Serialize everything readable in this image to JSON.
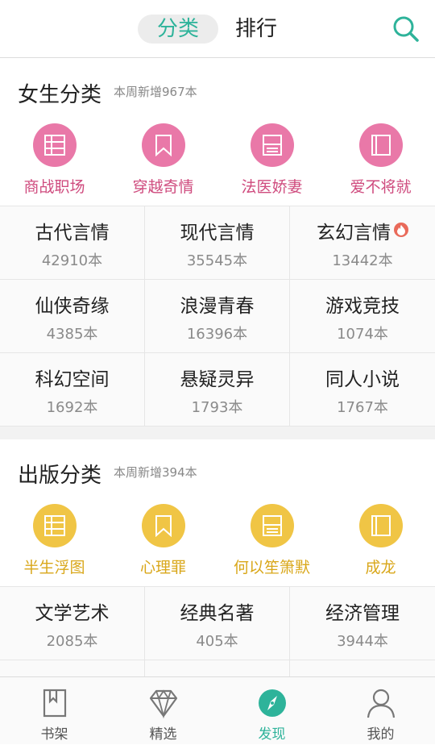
{
  "header": {
    "tabs": [
      {
        "label": "分类",
        "active": true
      },
      {
        "label": "排行",
        "active": false
      }
    ],
    "search_icon": "search-icon",
    "accent_color": "#2eb39a"
  },
  "female": {
    "title": "女生分类",
    "subtitle": "本周新增967本",
    "icon_color": "#e978a8",
    "icons": [
      {
        "label": "商战职场",
        "icon": "list-icon"
      },
      {
        "label": "穿越奇情",
        "icon": "bookmark-icon"
      },
      {
        "label": "法医娇妻",
        "icon": "document-icon"
      },
      {
        "label": "爱不将就",
        "icon": "book-icon"
      }
    ],
    "categories": [
      {
        "name": "古代言情",
        "count": "42910本"
      },
      {
        "name": "现代言情",
        "count": "35545本"
      },
      {
        "name": "玄幻言情",
        "count": "13442本",
        "hot": true
      },
      {
        "name": "仙侠奇缘",
        "count": "4385本"
      },
      {
        "name": "浪漫青春",
        "count": "16396本"
      },
      {
        "name": "游戏竞技",
        "count": "1074本"
      },
      {
        "name": "科幻空间",
        "count": "1692本"
      },
      {
        "name": "悬疑灵异",
        "count": "1793本"
      },
      {
        "name": "同人小说",
        "count": "1767本"
      }
    ]
  },
  "publish": {
    "title": "出版分类",
    "subtitle": "本周新增394本",
    "icon_color": "#f0c545",
    "icons": [
      {
        "label": "半生浮图",
        "icon": "list-icon"
      },
      {
        "label": "心理罪",
        "icon": "bookmark-icon"
      },
      {
        "label": "何以笙箫默",
        "icon": "document-icon"
      },
      {
        "label": "成龙",
        "icon": "book-icon"
      }
    ],
    "categories": [
      {
        "name": "文学艺术",
        "count": "2085本"
      },
      {
        "name": "经典名著",
        "count": "405本"
      },
      {
        "name": "经济管理",
        "count": "3944本"
      }
    ]
  },
  "bottom_nav": [
    {
      "label": "书架",
      "icon": "bookshelf-icon",
      "active": false
    },
    {
      "label": "精选",
      "icon": "diamond-icon",
      "active": false
    },
    {
      "label": "发现",
      "icon": "compass-icon",
      "active": true
    },
    {
      "label": "我的",
      "icon": "user-icon",
      "active": false
    }
  ]
}
